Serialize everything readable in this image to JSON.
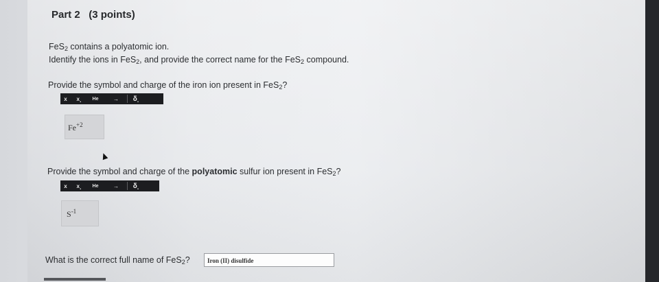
{
  "part": {
    "title": "Part 2",
    "points": "(3 points)"
  },
  "intro": {
    "line1_pre": "FeS",
    "line1_sub": "2",
    "line1_post": " contains a polyatomic ion.",
    "line2_a": "Identify the ions in FeS",
    "line2_sub1": "2",
    "line2_b": ", and provide the correct name for the FeS",
    "line2_sub2": "2",
    "line2_c": " compound."
  },
  "q1": {
    "pre": "Provide the symbol and charge of the iron ion present in FeS",
    "sub": "2",
    "post": "?"
  },
  "q2": {
    "pre": "Provide the symbol and charge of the ",
    "bold": "polyatomic",
    "mid": " sulfur ion present in FeS",
    "sub": "2",
    "post": "?"
  },
  "q3": {
    "pre": "What is the correct full name of FeS",
    "sub": "2",
    "post": "?"
  },
  "toolbar": {
    "superscript": "x",
    "subscript": "x",
    "he": "He",
    "arrow": "→",
    "delta": "δ"
  },
  "answers": {
    "iron_symbol": "Fe",
    "iron_charge": "+2",
    "sulfur_symbol": "S",
    "sulfur_charge": "-1",
    "name_value": "Iron (II) disulfide"
  }
}
